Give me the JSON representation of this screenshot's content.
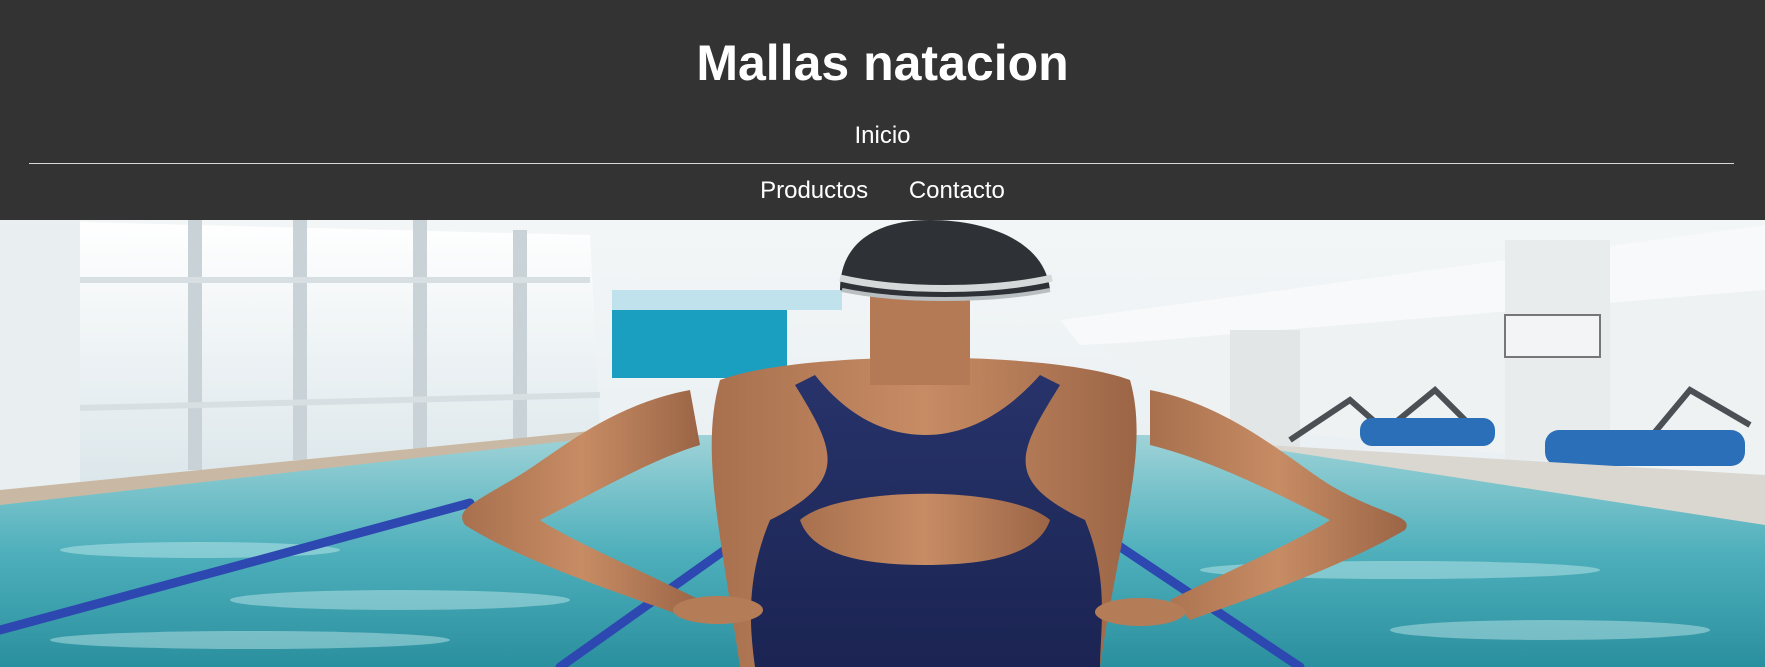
{
  "header": {
    "title": "Mallas natacion",
    "nav_primary": [
      {
        "label": "Inicio"
      }
    ],
    "nav_secondary": [
      {
        "label": "Productos"
      },
      {
        "label": "Contacto"
      }
    ]
  },
  "colors": {
    "header_background": "#333333",
    "header_text": "#ffffff",
    "divider": "#d8d8d8"
  },
  "hero": {
    "image_subject": "swimmer-at-indoor-pool"
  }
}
